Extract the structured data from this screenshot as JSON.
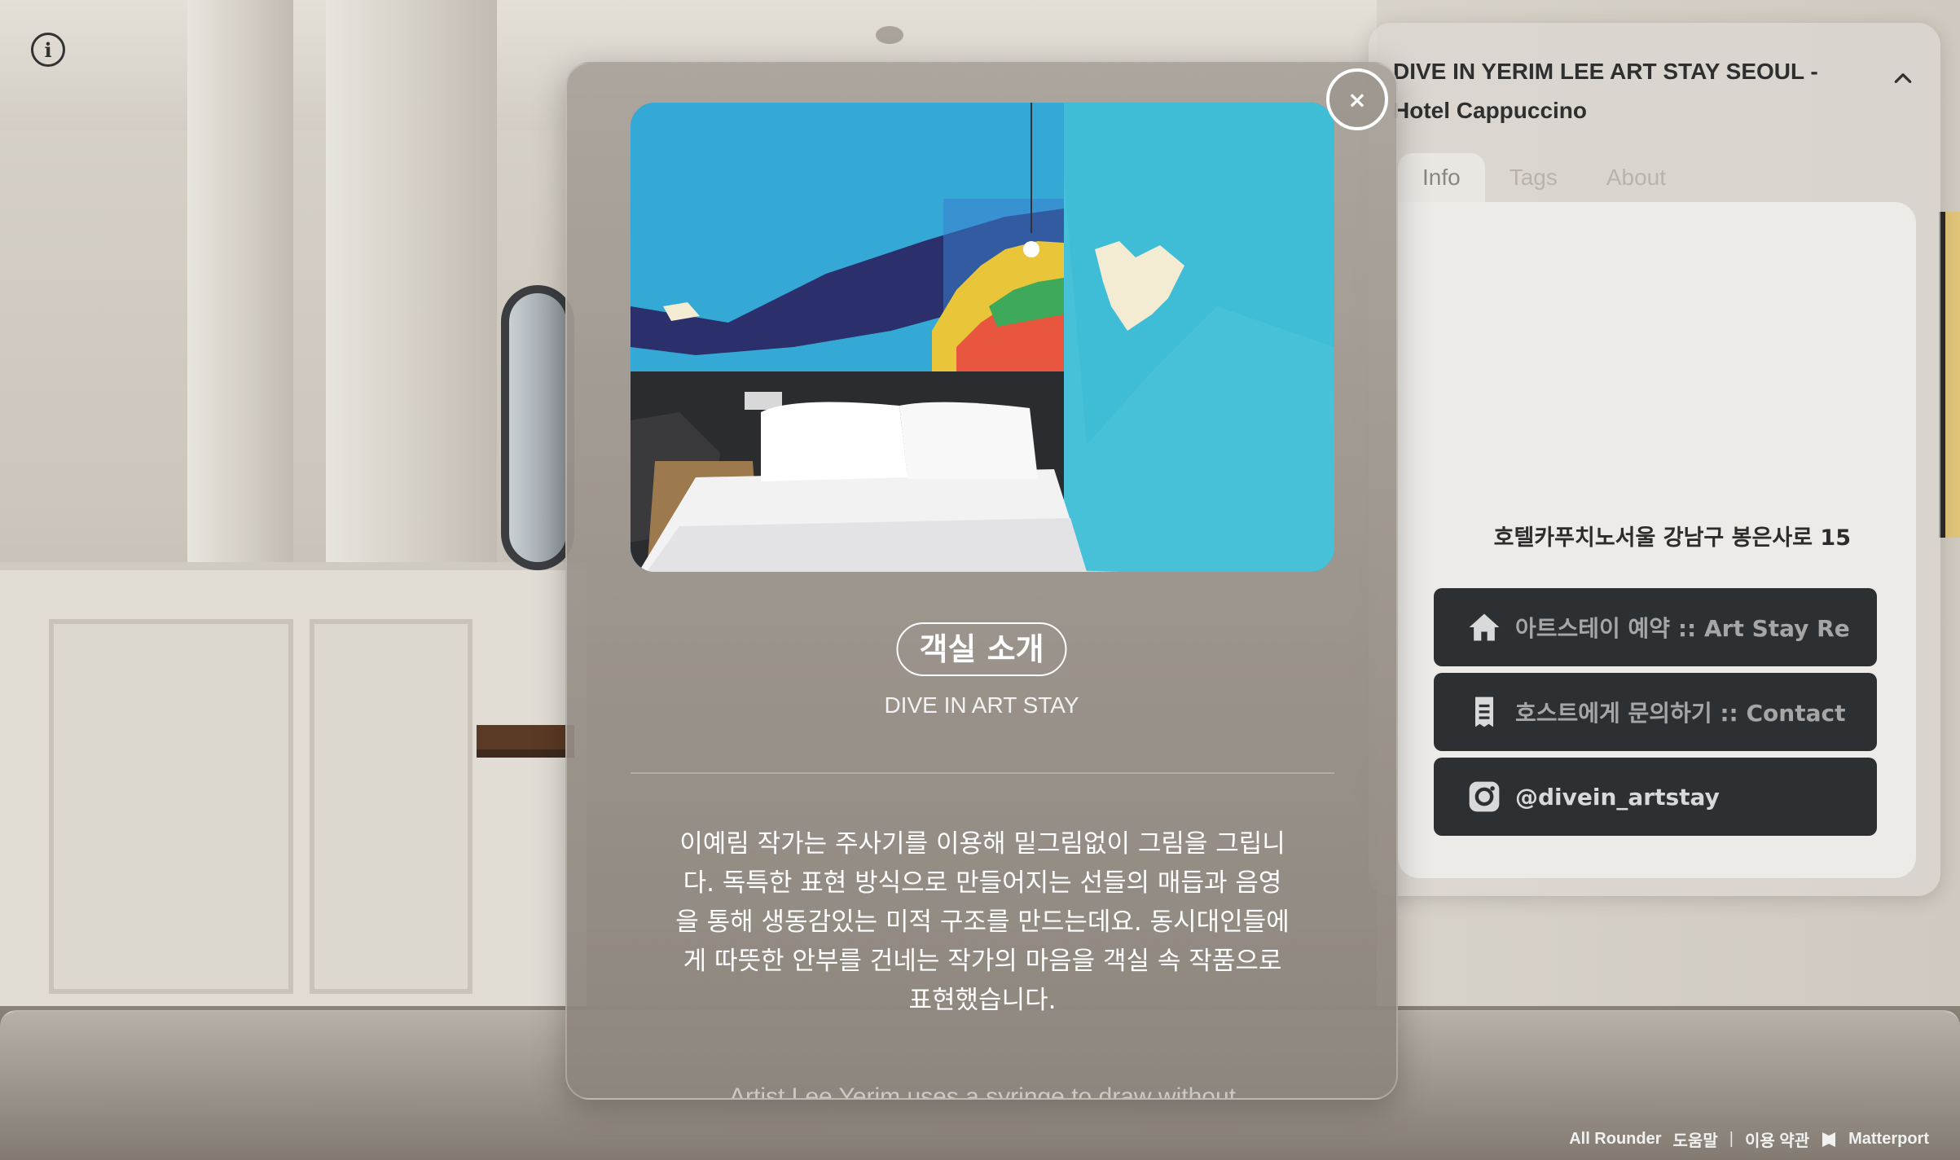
{
  "side_panel": {
    "title": "DIVE IN YERIM LEE ART STAY SEOUL - Hotel Cappuccino",
    "tabs": [
      {
        "label": "Info",
        "active": true
      },
      {
        "label": "Tags",
        "active": false
      },
      {
        "label": "About",
        "active": false
      }
    ],
    "address": "호텔카푸치노서울 강남구 봉은사로 15",
    "buttons": [
      {
        "icon": "home-icon",
        "label": "아트스테이 예약 :: Art Stay Reservation"
      },
      {
        "icon": "document-icon",
        "label": "호스트에게 문의하기 :: Contact the host"
      },
      {
        "icon": "instagram-icon",
        "label": "@divein_artstay"
      }
    ]
  },
  "modal": {
    "title": "객실 소개",
    "subtitle": "DIVE IN ART STAY",
    "body": "이예림 작가는 주사기를 이용해 밑그림없이 그림을 그립니다. 독특한 표현 방식으로 만들어지는 선들의 매듭과 음영을 통해 생동감있는 미적 구조를 만드는데요. 동시대인들에게 따뜻한 안부를 건네는 작가의 마음을 객실 속 작품으로 표현했습니다.",
    "body_en": "Artist Lee Yerim uses a syringe to draw without",
    "close_label": "×"
  },
  "footer": {
    "all_rounder": "All Rounder",
    "help": "도움말",
    "terms": "이용 약관",
    "brand": "Matterport"
  },
  "colors": {
    "button_bg": "#2d3033",
    "panel_bg": "#dcd8d2",
    "wall_teal": "#2fb3d3"
  }
}
